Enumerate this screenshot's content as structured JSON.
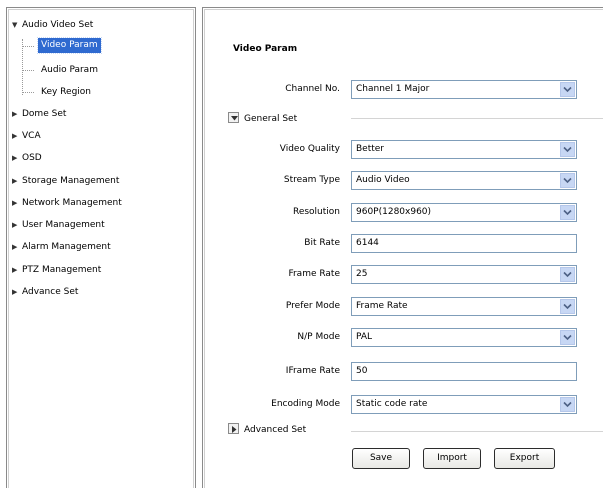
{
  "sidebar": {
    "items": [
      {
        "label": "Audio Video Set",
        "expanded": true
      },
      {
        "label": "Dome Set"
      },
      {
        "label": "VCA"
      },
      {
        "label": "OSD"
      },
      {
        "label": "Storage Management"
      },
      {
        "label": "Network Management"
      },
      {
        "label": "User Management"
      },
      {
        "label": "Alarm Management"
      },
      {
        "label": "PTZ Management"
      },
      {
        "label": "Advance Set"
      }
    ],
    "audio_video_children": [
      {
        "label": "Video Param",
        "selected": true
      },
      {
        "label": "Audio Param"
      },
      {
        "label": "Key Region"
      }
    ]
  },
  "main": {
    "title": "Video Param",
    "channel": {
      "label": "Channel No.",
      "value": "Channel 1 Major"
    },
    "general_set": {
      "title": "General Set",
      "expanded": true,
      "fields": [
        {
          "label": "Video Quality",
          "value": "Better",
          "type": "select"
        },
        {
          "label": "Stream Type",
          "value": "Audio Video",
          "type": "select"
        },
        {
          "label": "Resolution",
          "value": "960P(1280x960)",
          "type": "select"
        },
        {
          "label": "Bit Rate",
          "value": "6144",
          "type": "text"
        },
        {
          "label": "Frame Rate",
          "value": "25",
          "type": "select"
        },
        {
          "label": "Prefer Mode",
          "value": "Frame Rate",
          "type": "select"
        },
        {
          "label": "N/P Mode",
          "value": "PAL",
          "type": "select"
        },
        {
          "label": "IFrame Rate",
          "value": "50",
          "type": "text"
        },
        {
          "label": "Encoding Mode",
          "value": "Static code rate",
          "type": "select"
        }
      ]
    },
    "advanced_set": {
      "title": "Advanced Set",
      "expanded": false
    },
    "buttons": {
      "save": "Save",
      "import": "Import",
      "export": "Export"
    }
  },
  "colors": {
    "selection": "#2f6ad0",
    "field_border": "#7f9db9",
    "dropdown_button": "#c7d7f4"
  }
}
